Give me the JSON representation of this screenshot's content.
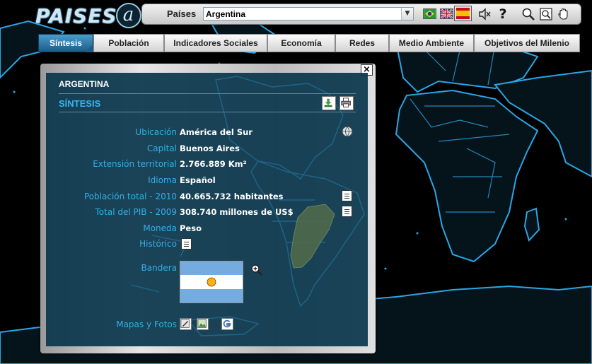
{
  "app": {
    "logo": "PAISES",
    "logo_badge": "a"
  },
  "toolbar": {
    "paises_label": "Países",
    "country_selected": "Argentina",
    "languages": [
      "brazil-flag-icon",
      "uk-flag-icon",
      "spain-flag-icon"
    ],
    "tools": [
      "speaker-icon",
      "help-icon",
      "zoom-icon",
      "zoom-window-icon",
      "pan-hand-icon"
    ],
    "help_label": "?"
  },
  "tabs": [
    {
      "label": "Síntesis",
      "active": true
    },
    {
      "label": "Población",
      "active": false
    },
    {
      "label": "Indicadores Sociales",
      "active": false
    },
    {
      "label": "Economía",
      "active": false
    },
    {
      "label": "Redes",
      "active": false
    },
    {
      "label": "Medio Ambiente",
      "active": false
    },
    {
      "label": "Objetivos del Milenio",
      "active": false
    }
  ],
  "panel": {
    "close_label": "×",
    "country": "ARGENTINA",
    "section": "SÍNTESIS",
    "rows": [
      {
        "label": "Ubicación",
        "value": "América del Sur"
      },
      {
        "label": "Capital",
        "value": "Buenos Aires"
      },
      {
        "label": "Extensión territorial",
        "value": "2.766.889 Km²"
      },
      {
        "label": "Idioma",
        "value": "Español"
      },
      {
        "label": "Población total - 2010",
        "value": "40.665.732 habitantes"
      },
      {
        "label": "Total del PIB - 2009",
        "value": "308.740 millones de US$"
      },
      {
        "label": "Moneda",
        "value": "Peso"
      },
      {
        "label": "Histórico",
        "value": ""
      }
    ],
    "flag_label": "Bandera",
    "maps_label": "Mapas y Fotos"
  },
  "colors": {
    "accent": "#33aee6",
    "panel_bg": "#0c374e",
    "coastline": "#2aa6e6",
    "highlight_country": "#4f6a4c",
    "tab_active": "#1b5c88"
  }
}
